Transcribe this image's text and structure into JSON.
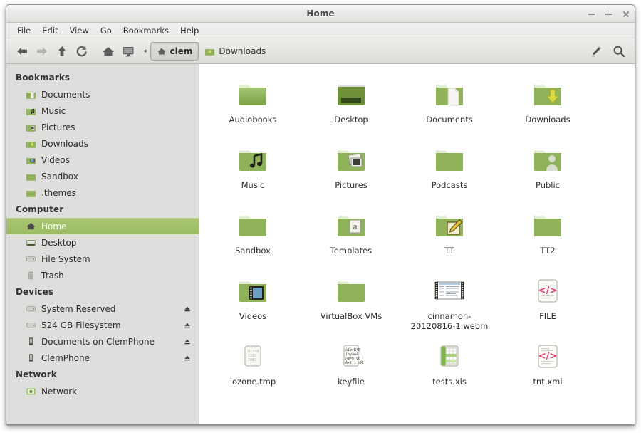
{
  "window": {
    "title": "Home",
    "controls": [
      {
        "name": "minimize",
        "glyph": "−"
      },
      {
        "name": "maximize",
        "glyph": "+"
      },
      {
        "name": "close",
        "glyph": "×"
      }
    ]
  },
  "menubar": {
    "items": [
      {
        "label": "File"
      },
      {
        "label": "Edit"
      },
      {
        "label": "View"
      },
      {
        "label": "Go"
      },
      {
        "label": "Bookmarks"
      },
      {
        "label": "Help"
      }
    ]
  },
  "toolbar": {
    "buttons": [
      {
        "name": "back-button",
        "icon": "arrow-left-icon",
        "enabled": true
      },
      {
        "name": "forward-button",
        "icon": "arrow-right-icon",
        "enabled": false
      },
      {
        "name": "up-button",
        "icon": "arrow-up-icon",
        "enabled": true
      },
      {
        "name": "reload-button",
        "icon": "reload-icon",
        "enabled": true
      },
      {
        "name": "home-button",
        "icon": "home-icon",
        "enabled": true
      },
      {
        "name": "computer-button",
        "icon": "computer-icon",
        "enabled": true
      }
    ],
    "collapse_glyph": "◂",
    "breadcrumbs": [
      {
        "label": "clem",
        "icon": "home-icon",
        "active": true
      },
      {
        "label": "Downloads",
        "icon": "folder-downloads-icon",
        "active": false
      }
    ],
    "right_buttons": [
      {
        "name": "edit-location-button",
        "icon": "pencil-icon"
      },
      {
        "name": "search-button",
        "icon": "search-icon"
      }
    ]
  },
  "sidebar": {
    "sections": [
      {
        "heading": "Bookmarks",
        "items": [
          {
            "label": "Documents",
            "icon": "folder-documents-icon",
            "selected": false,
            "eject": false
          },
          {
            "label": "Music",
            "icon": "folder-music-icon",
            "selected": false,
            "eject": false
          },
          {
            "label": "Pictures",
            "icon": "folder-pictures-icon",
            "selected": false,
            "eject": false
          },
          {
            "label": "Downloads",
            "icon": "folder-downloads-icon",
            "selected": false,
            "eject": false
          },
          {
            "label": "Videos",
            "icon": "folder-videos-icon",
            "selected": false,
            "eject": false
          },
          {
            "label": "Sandbox",
            "icon": "folder-icon",
            "selected": false,
            "eject": false
          },
          {
            "label": ".themes",
            "icon": "folder-icon",
            "selected": false,
            "eject": false
          }
        ]
      },
      {
        "heading": "Computer",
        "items": [
          {
            "label": "Home",
            "icon": "home-icon",
            "selected": true,
            "eject": false
          },
          {
            "label": "Desktop",
            "icon": "desktop-icon",
            "selected": false,
            "eject": false
          },
          {
            "label": "File System",
            "icon": "drive-harddisk-icon",
            "selected": false,
            "eject": false
          },
          {
            "label": "Trash",
            "icon": "trash-icon",
            "selected": false,
            "eject": false
          }
        ]
      },
      {
        "heading": "Devices",
        "items": [
          {
            "label": "System Reserved",
            "icon": "drive-harddisk-icon",
            "selected": false,
            "eject": true
          },
          {
            "label": "524 GB Filesystem",
            "icon": "drive-harddisk-icon",
            "selected": false,
            "eject": true
          },
          {
            "label": "Documents on ClemPhone",
            "icon": "phone-icon",
            "selected": false,
            "eject": true
          },
          {
            "label": "ClemPhone",
            "icon": "phone-icon",
            "selected": false,
            "eject": true
          }
        ]
      },
      {
        "heading": "Network",
        "items": [
          {
            "label": "Network",
            "icon": "network-icon",
            "selected": false,
            "eject": false
          }
        ]
      }
    ]
  },
  "fileview": {
    "items": [
      {
        "label": "Audiobooks",
        "icon": "folder-icon"
      },
      {
        "label": "Desktop",
        "icon": "folder-desktop-icon"
      },
      {
        "label": "Documents",
        "icon": "folder-documents-icon"
      },
      {
        "label": "Downloads",
        "icon": "folder-downloads-icon"
      },
      {
        "label": "Music",
        "icon": "folder-music-icon"
      },
      {
        "label": "Pictures",
        "icon": "folder-pictures-icon"
      },
      {
        "label": "Podcasts",
        "icon": "folder-icon"
      },
      {
        "label": "Public",
        "icon": "folder-public-icon"
      },
      {
        "label": "Sandbox",
        "icon": "folder-icon"
      },
      {
        "label": "Templates",
        "icon": "folder-templates-icon"
      },
      {
        "label": "TT",
        "icon": "folder-edit-icon"
      },
      {
        "label": "TT2",
        "icon": "folder-icon"
      },
      {
        "label": "Videos",
        "icon": "folder-videos-icon"
      },
      {
        "label": "VirtualBox VMs",
        "icon": "folder-icon"
      },
      {
        "label": "cinnamon-20120816-1.webm",
        "label_lines": [
          "cinnamon-",
          "20120816-1.webm"
        ],
        "icon": "video-thumbnail-icon"
      },
      {
        "label": "FILE",
        "icon": "xml-file-icon"
      },
      {
        "label": "iozone.tmp",
        "icon": "binary-file-icon",
        "preview_lines": [
          "01100",
          "1101",
          "1001"
        ]
      },
      {
        "label": "keyfile",
        "icon": "text-file-icon",
        "preview_lines": [
          "áIørR²E",
          ")hyàÀà",
          ">æ=ô³ÿ0",
          "À÷t ı »Ñ"
        ]
      },
      {
        "label": "tests.xls",
        "icon": "spreadsheet-file-icon"
      },
      {
        "label": "tnt.xml",
        "icon": "xml-file-icon"
      }
    ]
  },
  "colors": {
    "selection_green": "#a4c26a",
    "folder_green": "#8fb25a",
    "xml_pink": "#e8376f",
    "download_arrow": "#d7d943"
  }
}
